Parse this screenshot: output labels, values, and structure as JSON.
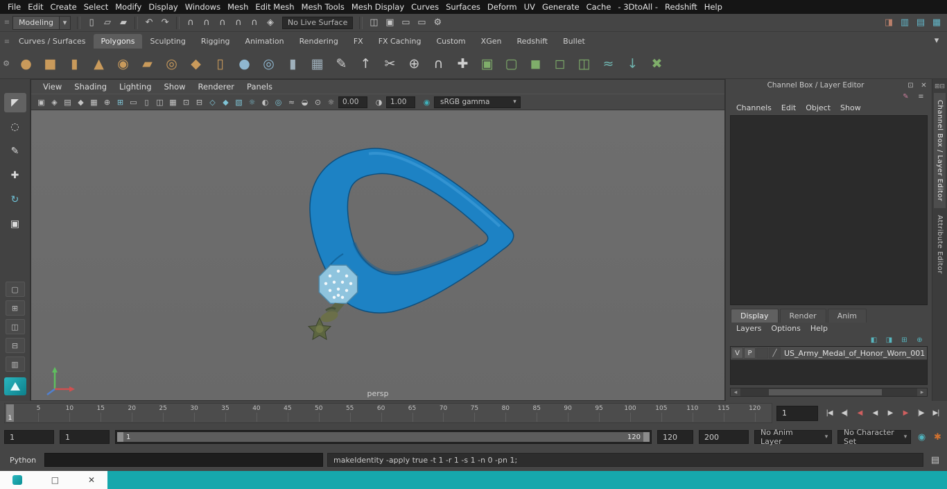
{
  "colors": {
    "accent_teal": "#16a7ac",
    "ribbon_blue": "#1d82c4",
    "viewport_bg": "#6a6a6a"
  },
  "menubar": {
    "items": [
      "File",
      "Edit",
      "Create",
      "Select",
      "Modify",
      "Display",
      "Windows",
      "Mesh",
      "Edit Mesh",
      "Mesh Tools",
      "Mesh Display",
      "Curves",
      "Surfaces",
      "Deform",
      "UV",
      "Generate",
      "Cache",
      "- 3DtoAll -",
      "Redshift",
      "Help"
    ]
  },
  "statusline": {
    "menu_set": "Modeling",
    "live_surface": "No Live Surface",
    "file_icons": [
      {
        "name": "new-scene-icon",
        "glyph": "▯"
      },
      {
        "name": "open-scene-icon",
        "glyph": "▱"
      },
      {
        "name": "save-scene-icon",
        "glyph": "▰"
      }
    ],
    "history_icons": [
      {
        "name": "undo-icon",
        "glyph": "↶"
      },
      {
        "name": "redo-icon",
        "glyph": "↷"
      }
    ],
    "snap_icons": [
      {
        "name": "snap-to-grids-icon",
        "glyph": "∩"
      },
      {
        "name": "snap-to-curves-icon",
        "glyph": "∩"
      },
      {
        "name": "snap-to-points-icon",
        "glyph": "∩"
      },
      {
        "name": "snap-to-projected-center-icon",
        "glyph": "∩"
      },
      {
        "name": "snap-to-view-planes-icon",
        "glyph": "∩"
      },
      {
        "name": "make-live-icon",
        "glyph": "◈"
      }
    ],
    "render_icons": [
      {
        "name": "symmetry-icon",
        "glyph": "◫"
      },
      {
        "name": "highlight-selection-icon",
        "glyph": "▣"
      },
      {
        "name": "render-frame-icon",
        "glyph": "▭"
      },
      {
        "name": "ipr-render-icon",
        "glyph": "▭"
      },
      {
        "name": "render-settings-icon",
        "glyph": "⚙"
      }
    ],
    "sidebar_icons": [
      {
        "name": "raise-panels-icon",
        "glyph": "◨",
        "color": "#b97f6a"
      },
      {
        "name": "modeling-toolkit-icon",
        "glyph": "▥",
        "color": "#63b7c9"
      },
      {
        "name": "channel-box-toggle-icon",
        "glyph": "▤",
        "color": "#63b7c9"
      },
      {
        "name": "workspace-icon",
        "glyph": "▦",
        "color": "#63b7c9"
      }
    ]
  },
  "shelf": {
    "tabs": [
      {
        "label": "Curves / Surfaces"
      },
      {
        "label": "Polygons",
        "active": true
      },
      {
        "label": "Sculpting"
      },
      {
        "label": "Rigging"
      },
      {
        "label": "Animation"
      },
      {
        "label": "Rendering"
      },
      {
        "label": "FX"
      },
      {
        "label": "FX Caching"
      },
      {
        "label": "Custom"
      },
      {
        "label": "XGen"
      },
      {
        "label": "Redshift"
      },
      {
        "label": "Bullet"
      }
    ],
    "icons": [
      {
        "name": "poly-sphere-icon",
        "glyph": "●",
        "color": "#c99a5b"
      },
      {
        "name": "poly-cube-icon",
        "glyph": "■",
        "color": "#c99a5b"
      },
      {
        "name": "poly-cylinder-icon",
        "glyph": "▮",
        "color": "#c99a5b"
      },
      {
        "name": "poly-cone-icon",
        "glyph": "▲",
        "color": "#c99a5b"
      },
      {
        "name": "poly-torus-icon",
        "glyph": "◉",
        "color": "#c99a5b"
      },
      {
        "name": "poly-plane-icon",
        "glyph": "▰",
        "color": "#c99a5b"
      },
      {
        "name": "poly-disc-icon",
        "glyph": "◎",
        "color": "#c99a5b"
      },
      {
        "name": "poly-platonic-icon",
        "glyph": "◆",
        "color": "#c99a5b"
      },
      {
        "name": "poly-pipe-icon",
        "glyph": "▯",
        "color": "#c99a5b"
      },
      {
        "name": "sculpt-tool-icon",
        "glyph": "●",
        "color": "#8fb7d0"
      },
      {
        "name": "smooth-mesh-icon",
        "glyph": "◎",
        "color": "#8fb7d0"
      },
      {
        "name": "subdiv-proxy-icon",
        "glyph": "▮",
        "color": "#9fb0bb"
      },
      {
        "name": "quad-draw-icon",
        "glyph": "▦",
        "color": "#9fb0bb"
      },
      {
        "name": "create-polygon-icon",
        "glyph": "✎",
        "color": "#cfcfcf"
      },
      {
        "name": "extrude-icon",
        "glyph": "↑",
        "color": "#cfcfcf"
      },
      {
        "name": "multi-cut-icon",
        "glyph": "✂",
        "color": "#cfcfcf"
      },
      {
        "name": "target-weld-icon",
        "glyph": "⊕",
        "color": "#cfcfcf"
      },
      {
        "name": "bridge-icon",
        "glyph": "∩",
        "color": "#cfcfcf"
      },
      {
        "name": "append-polygon-icon",
        "glyph": "✚",
        "color": "#cfcfcf"
      },
      {
        "name": "combine-icon",
        "glyph": "▣",
        "color": "#7fae6a"
      },
      {
        "name": "separate-icon",
        "glyph": "▢",
        "color": "#7fae6a"
      },
      {
        "name": "boolean-union-icon",
        "glyph": "◼",
        "color": "#7fae6a"
      },
      {
        "name": "boolean-difference-icon",
        "glyph": "◻",
        "color": "#7fae6a"
      },
      {
        "name": "mirror-icon",
        "glyph": "◫",
        "color": "#7fae6a"
      },
      {
        "name": "smooth-icon",
        "glyph": "≈",
        "color": "#6fb3ae"
      },
      {
        "name": "reduce-icon",
        "glyph": "↓",
        "color": "#6fb3ae"
      },
      {
        "name": "delete-history-icon",
        "glyph": "✖",
        "color": "#7fae6a"
      }
    ]
  },
  "toolbox": {
    "tools": [
      {
        "name": "select-tool",
        "glyph": "◤",
        "active": true
      },
      {
        "name": "lasso-tool",
        "glyph": "◌"
      },
      {
        "name": "paint-select-tool",
        "glyph": "✎"
      },
      {
        "name": "move-tool",
        "glyph": "✚"
      },
      {
        "name": "rotate-tool",
        "glyph": "↻",
        "color": "#6fc3d8"
      },
      {
        "name": "scale-tool",
        "glyph": "▣"
      }
    ],
    "layouts": [
      {
        "name": "single-pane-layout-icon",
        "glyph": "▢"
      },
      {
        "name": "four-pane-layout-icon",
        "glyph": "⊞"
      },
      {
        "name": "persp-outliner-layout-icon",
        "glyph": "◫"
      },
      {
        "name": "persp-graph-layout-icon",
        "glyph": "⊟"
      },
      {
        "name": "hypershade-layout-icon",
        "glyph": "▥"
      }
    ]
  },
  "viewport": {
    "menus": [
      "View",
      "Shading",
      "Lighting",
      "Show",
      "Renderer",
      "Panels"
    ],
    "toolbar_icons": [
      {
        "name": "select-camera-icon",
        "glyph": "▣"
      },
      {
        "name": "lock-camera-icon",
        "glyph": "◈"
      },
      {
        "name": "camera-attributes-icon",
        "glyph": "▤"
      },
      {
        "name": "bookmark-icon",
        "glyph": "◆"
      },
      {
        "name": "image-plane-icon",
        "glyph": "▦"
      },
      {
        "name": "pan-zoom-icon",
        "glyph": "⊕"
      },
      {
        "name": "grid-icon",
        "glyph": "⊞",
        "color": "#7fc4d6"
      },
      {
        "name": "film-gate-icon",
        "glyph": "▭"
      },
      {
        "name": "resolution-gate-icon",
        "glyph": "▯"
      },
      {
        "name": "gate-mask-icon",
        "glyph": "◫"
      },
      {
        "name": "field-chart-icon",
        "glyph": "▦"
      },
      {
        "name": "safe-action-icon",
        "glyph": "⊡"
      },
      {
        "name": "safe-title-icon",
        "glyph": "⊟"
      },
      {
        "name": "wireframe-icon",
        "glyph": "◇",
        "color": "#7fc4d6"
      },
      {
        "name": "smooth-shade-icon",
        "glyph": "◆",
        "color": "#7fc4d6"
      },
      {
        "name": "textured-icon",
        "glyph": "▧",
        "color": "#7fc4d6"
      },
      {
        "name": "use-lights-icon",
        "glyph": "☼",
        "color": "#7fc4d6"
      },
      {
        "name": "shadows-icon",
        "glyph": "◐"
      },
      {
        "name": "ambient-occlusion-icon",
        "glyph": "◎",
        "color": "#7fc4d6"
      },
      {
        "name": "motion-blur-icon",
        "glyph": "≈"
      },
      {
        "name": "xray-icon",
        "glyph": "◒"
      },
      {
        "name": "isolate-select-icon",
        "glyph": "⊙"
      }
    ],
    "exposure": "0.00",
    "gamma": "1.00",
    "view_transform": "sRGB gamma",
    "camera_label": "persp"
  },
  "channel_box": {
    "title": "Channel Box / Layer Editor",
    "sub_icons": [
      {
        "name": "paint-attr-icon",
        "glyph": "✎",
        "color": "#cc7f9e"
      },
      {
        "name": "channel-settings-icon",
        "glyph": "≡",
        "color": "#b9b9b9"
      }
    ],
    "menus": [
      "Channels",
      "Edit",
      "Object",
      "Show"
    ],
    "layer_tabs": [
      {
        "label": "Display",
        "active": true
      },
      {
        "label": "Render"
      },
      {
        "label": "Anim"
      }
    ],
    "layer_menus": [
      "Layers",
      "Options",
      "Help"
    ],
    "layer_action_icons": [
      {
        "name": "layer-move-up-icon",
        "glyph": "◧"
      },
      {
        "name": "layer-move-down-icon",
        "glyph": "◨"
      },
      {
        "name": "new-empty-layer-icon",
        "glyph": "⊞"
      },
      {
        "name": "new-layer-from-selected-icon",
        "glyph": "⊕"
      }
    ],
    "layer_row": {
      "visibility": "V",
      "playback": "P",
      "name": "US_Army_Medal_of_Honor_Worn_001"
    }
  },
  "sidebar": {
    "icons": [
      {
        "name": "dock-grid-icon",
        "glyph": "⊞"
      },
      {
        "name": "dock-list-icon",
        "glyph": "⊟"
      }
    ],
    "tabs": [
      {
        "label": "Channel Box / Layer Editor",
        "active": true
      },
      {
        "label": "Attribute Editor"
      }
    ]
  },
  "timeline": {
    "tick_labels": [
      "5",
      "10",
      "15",
      "20",
      "25",
      "30",
      "35",
      "40",
      "45",
      "50",
      "55",
      "60",
      "65",
      "70",
      "75",
      "80",
      "85",
      "90",
      "95",
      "100",
      "105",
      "110",
      "115",
      "120"
    ],
    "current_marker": "1",
    "current_frame": "1",
    "playback_buttons": [
      {
        "name": "go-to-start-button",
        "glyph": "|◀"
      },
      {
        "name": "step-back-frame-button",
        "glyph": "◀|"
      },
      {
        "name": "step-back-key-button",
        "glyph": "◀",
        "color": "#cf5f5f"
      },
      {
        "name": "play-backwards-button",
        "glyph": "◀"
      },
      {
        "name": "play-forwards-button",
        "glyph": "▶"
      },
      {
        "name": "step-forward-key-button",
        "glyph": "▶",
        "color": "#cf5f5f"
      },
      {
        "name": "step-forward-frame-button",
        "glyph": "|▶"
      },
      {
        "name": "go-to-end-button",
        "glyph": "▶|"
      }
    ]
  },
  "range": {
    "anim_start": "1",
    "playback_start": "1",
    "range_start_label": "1",
    "range_end_label": "120",
    "playback_end": "120",
    "anim_end": "200",
    "anim_layer": "No Anim Layer",
    "character_set": "No Character Set",
    "icons": [
      {
        "name": "anim-layer-preferences-icon",
        "glyph": "◉",
        "color": "#4fb3bd"
      },
      {
        "name": "auto-keyframe-icon",
        "glyph": "✱",
        "color": "#d2722f"
      }
    ]
  },
  "command_line": {
    "label": "Python",
    "input_value": "",
    "output": "makeIdentity -apply true -t 1 -r 1 -s 1 -n 0 -pn 1;"
  },
  "taskbar": {
    "maximize": "□",
    "close": "✕"
  }
}
